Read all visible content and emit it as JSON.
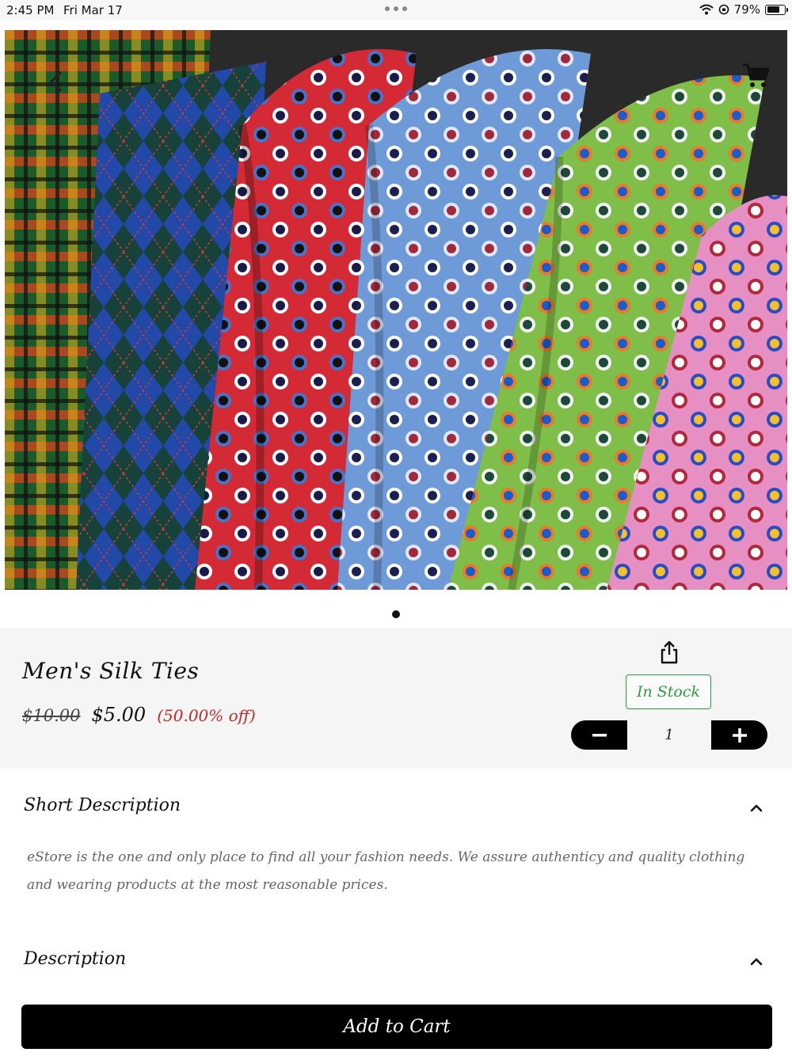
{
  "status_bar": {
    "time": "2:45 PM",
    "date": "Fri Mar 17",
    "battery": "79%",
    "battery_level": 0.79
  },
  "hero": {
    "image_subject": "colorful silk ties",
    "pager_count": 1,
    "pager_active": 0
  },
  "product": {
    "name": "Men's Silk Ties",
    "original_price": "$10.00",
    "price": "$5.00",
    "discount": "(50.00% off)",
    "stock_status": "In Stock",
    "quantity": "1",
    "minus_symbol": "−",
    "plus_symbol": "+"
  },
  "sections": {
    "short_description": {
      "title": "Short Description",
      "body": "eStore is the one and only place to find all your fashion needs. We assure authenticy and quality clothing and wearing products at the most reasonable prices."
    },
    "description": {
      "title": "Description"
    }
  },
  "actions": {
    "add_to_cart": "Add to Cart"
  },
  "colors": {
    "stock_green": "#2e9b43",
    "discount_red": "#c62828",
    "button_black": "#000000",
    "panel_bg": "#f5f5f5"
  },
  "icons": {
    "back": "chevron-left-icon",
    "cart": "shopping-cart-icon",
    "share": "share-icon",
    "collapse": "chevron-up-icon"
  }
}
